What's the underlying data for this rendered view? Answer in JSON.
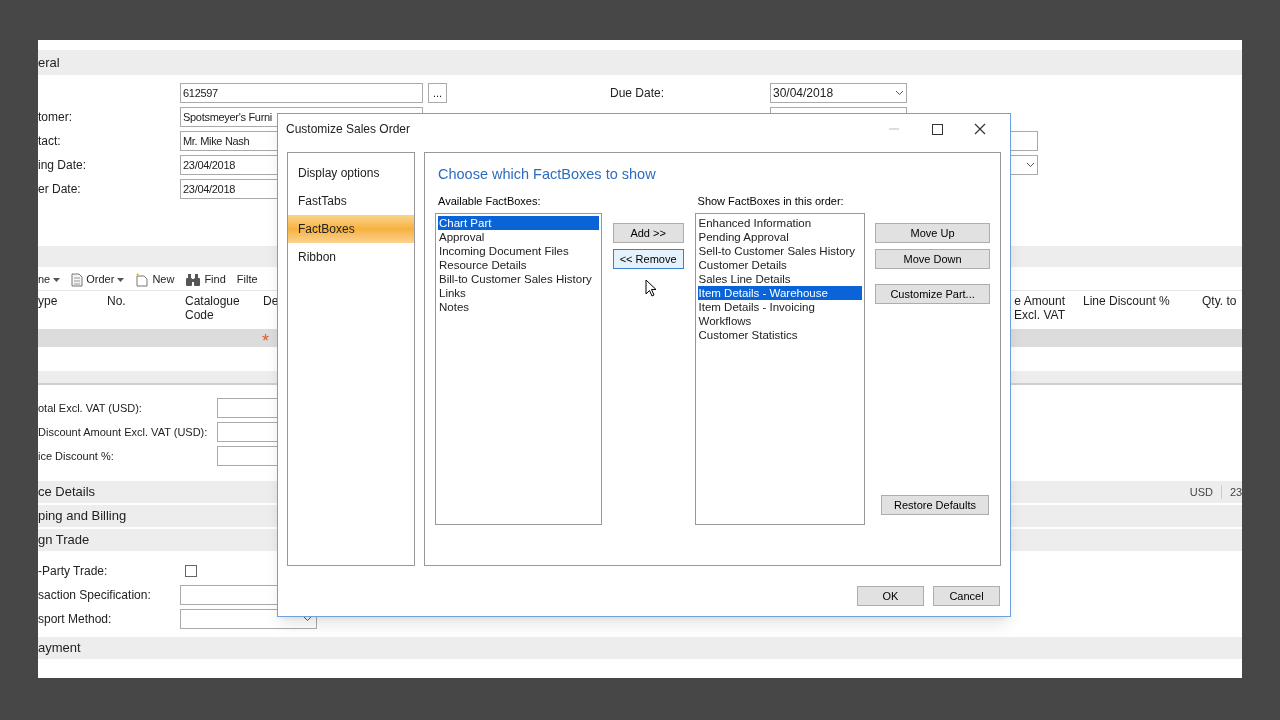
{
  "general": {
    "title": "eral",
    "left_fields": [
      {
        "kind": "lookup",
        "value": "612597",
        "button": "..."
      },
      {
        "kind": "text",
        "label": "tomer:",
        "value": "Spotsmeyer's Furni"
      },
      {
        "kind": "text",
        "label": "tact:",
        "value": "Mr. Mike Nash"
      },
      {
        "kind": "text",
        "label": "ing Date:",
        "value": "23/04/2018"
      },
      {
        "kind": "text",
        "label": "er Date:",
        "value": "23/04/2018"
      }
    ],
    "right_fields": [
      {
        "kind": "dropdown",
        "label": "Due Date:",
        "value": "30/04/2018"
      },
      {
        "kind": "text"
      },
      {
        "kind": "wide"
      },
      {
        "kind": "wide-dropdown"
      }
    ]
  },
  "lines": {
    "toolbar": [
      {
        "kind": "menu",
        "label": "ne"
      },
      {
        "kind": "document-menu",
        "label": "Order"
      },
      {
        "kind": "new",
        "label": "New"
      },
      {
        "kind": "find",
        "label": "Find"
      },
      {
        "kind": "text",
        "label": "Filte"
      }
    ],
    "columns_left": [
      "ype",
      "No.",
      "Catalogue Code",
      "De"
    ],
    "columns_right": [
      "e Amount Excl. VAT",
      "Line Discount %",
      "Qty. to"
    ],
    "new_row_marker": "*"
  },
  "totals": [
    {
      "label": "otal Excl. VAT (USD):"
    },
    {
      "label": "Discount Amount Excl. VAT (USD):"
    },
    {
      "label": "ice Discount %:"
    }
  ],
  "sections": [
    {
      "title": "ce Details",
      "status": [
        "USD",
        "23"
      ]
    },
    {
      "title": "ping and Billing"
    },
    {
      "title": "gn Trade",
      "fields": [
        {
          "kind": "checkbox",
          "label": "-Party Trade:",
          "checked": false
        },
        {
          "kind": "text",
          "label": "saction Specification:"
        },
        {
          "kind": "dropdown",
          "label": "sport Method:"
        }
      ]
    },
    {
      "title": "ayment"
    }
  ],
  "dialog": {
    "title": "Customize Sales Order",
    "nav": [
      {
        "label": "Display options",
        "selected": false
      },
      {
        "label": "FastTabs",
        "selected": false
      },
      {
        "label": "FactBoxes",
        "selected": true
      },
      {
        "label": "Ribbon",
        "selected": false
      }
    ],
    "heading": "Choose which FactBoxes to show",
    "available": {
      "label": "Available FactBoxes:",
      "items": [
        {
          "label": "Chart Part",
          "selected": true
        },
        {
          "label": "Approval",
          "selected": false
        },
        {
          "label": "Incoming Document Files",
          "selected": false
        },
        {
          "label": "Resource Details",
          "selected": false
        },
        {
          "label": "Bill-to Customer Sales History",
          "selected": false
        },
        {
          "label": "Links",
          "selected": false
        },
        {
          "label": "Notes",
          "selected": false
        }
      ]
    },
    "transfer_buttons": [
      {
        "label": "Add >>",
        "focused": false
      },
      {
        "label": "<< Remove",
        "focused": true
      }
    ],
    "shown": {
      "label": "Show FactBoxes in this order:",
      "items": [
        {
          "label": "Enhanced Information",
          "selected": false
        },
        {
          "label": "Pending Approval",
          "selected": false
        },
        {
          "label": "Sell-to Customer Sales History",
          "selected": false
        },
        {
          "label": "Customer Details",
          "selected": false
        },
        {
          "label": "Sales Line Details",
          "selected": false
        },
        {
          "label": "Item Details - Warehouse",
          "selected": true
        },
        {
          "label": "Item Details - Invoicing",
          "selected": false
        },
        {
          "label": "Workflows",
          "selected": false
        },
        {
          "label": "Customer Statistics",
          "selected": false
        }
      ]
    },
    "order_buttons": [
      "Move Up",
      "Move Down",
      "Customize Part..."
    ],
    "restore_button": "Restore Defaults",
    "footer_buttons": [
      "OK",
      "Cancel"
    ]
  }
}
